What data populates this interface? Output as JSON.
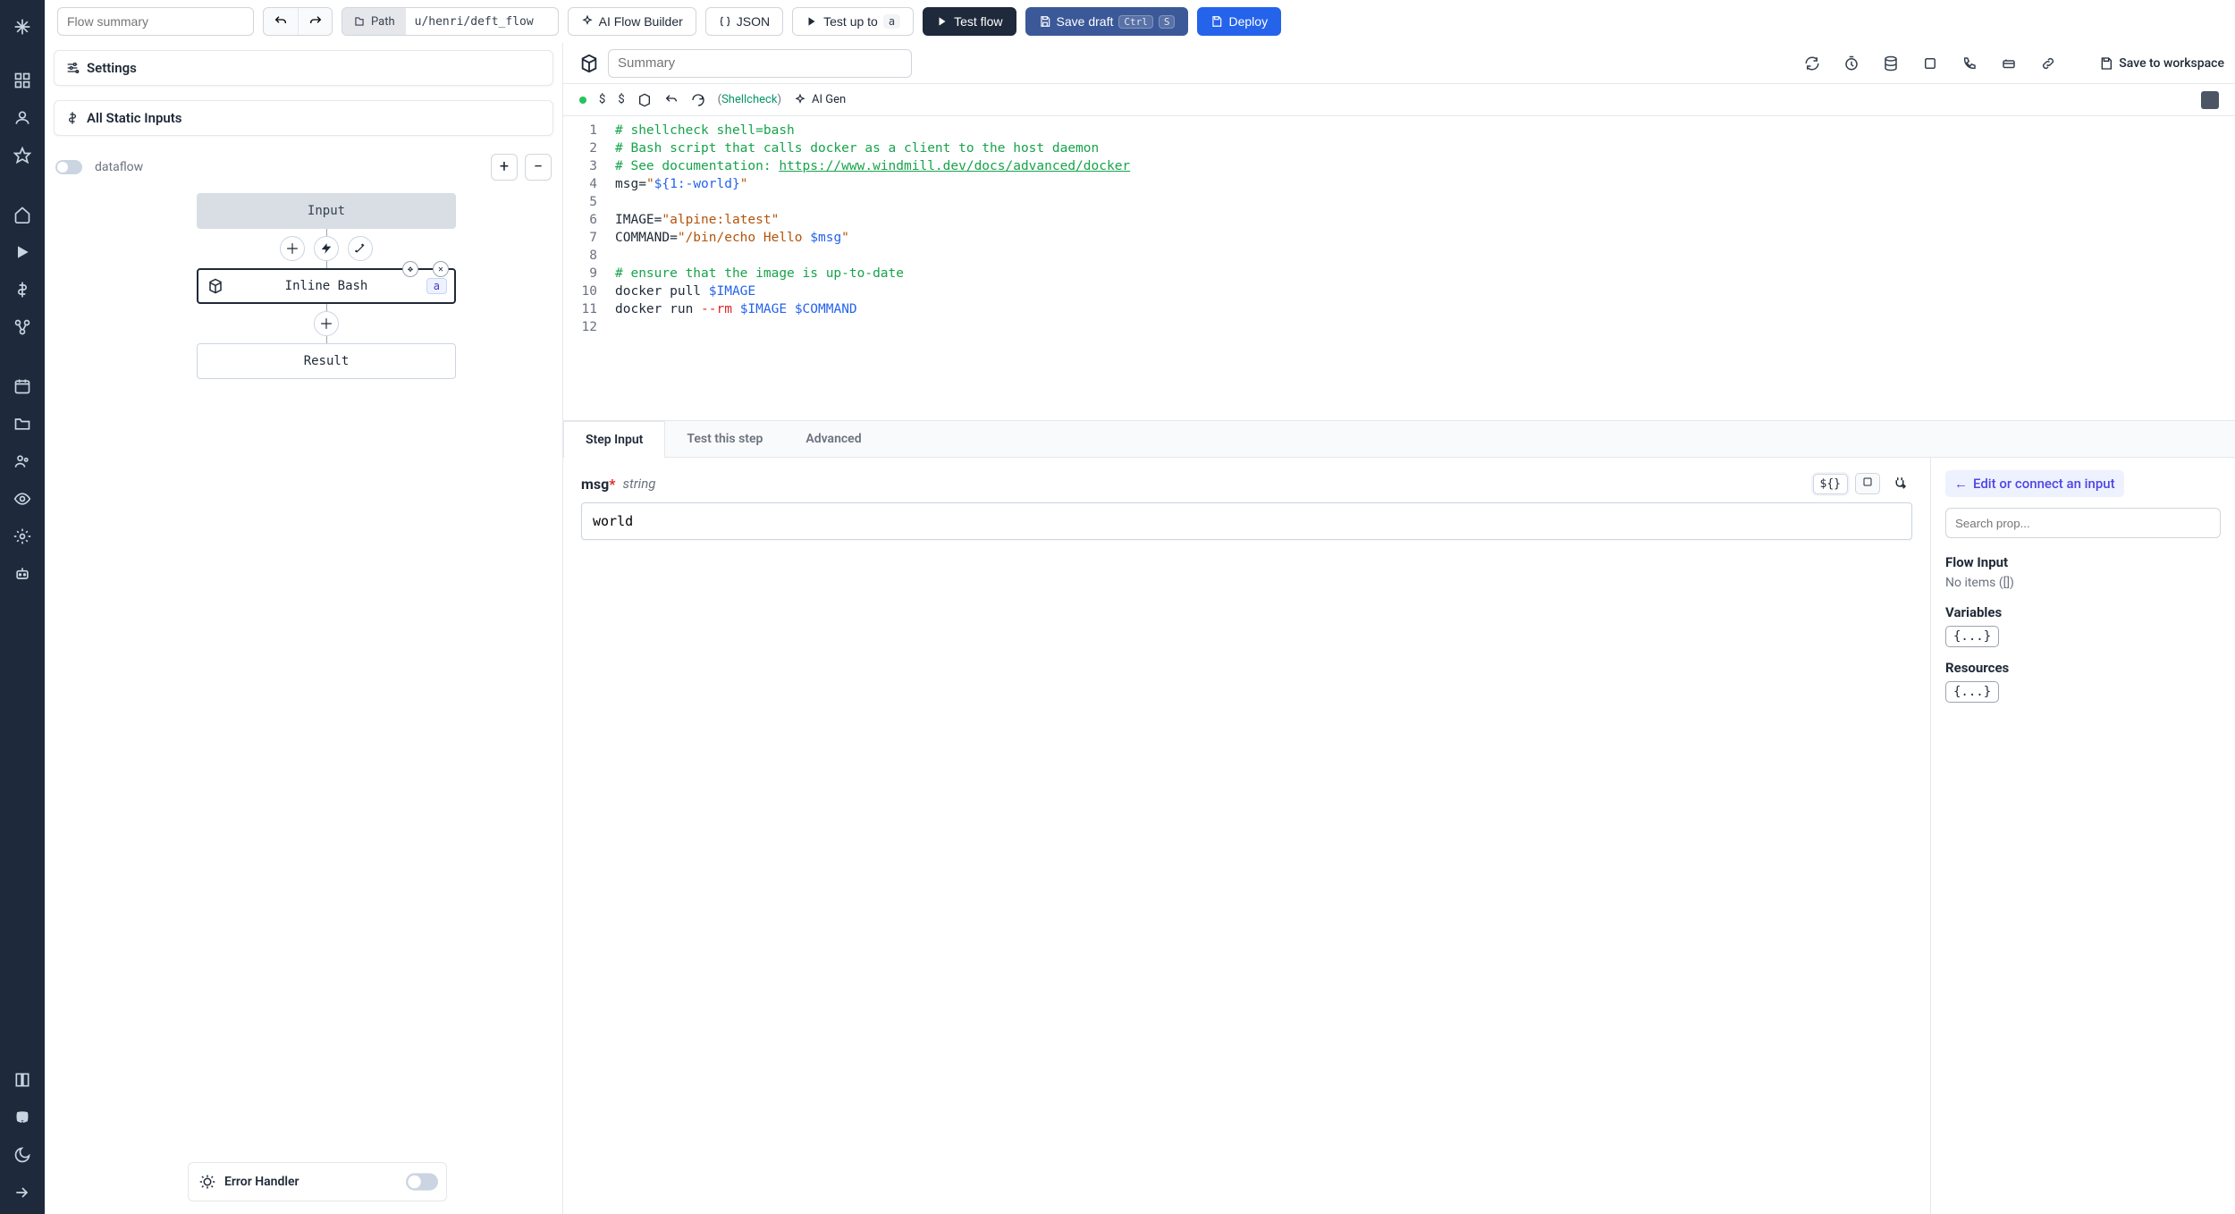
{
  "toolbar": {
    "summary_placeholder": "Flow summary",
    "path_label": "Path",
    "path_value": "u/henri/deft_flow",
    "ai_flow_builder": "AI Flow Builder",
    "json": "JSON",
    "test_up_to": "Test up to",
    "test_up_to_badge": "a",
    "test_flow": "Test flow",
    "save_draft": "Save draft",
    "save_draft_kbd1": "Ctrl",
    "save_draft_kbd2": "S",
    "deploy": "Deploy"
  },
  "cards": {
    "settings": "Settings",
    "all_static_inputs": "All Static Inputs"
  },
  "canvas": {
    "dataflow_label": "dataflow",
    "dataflow_on": false,
    "nodes": {
      "input": "Input",
      "step_a": "Inline Bash",
      "step_a_badge": "a",
      "result": "Result"
    },
    "error_handler": "Error Handler"
  },
  "editor_toolbar": {
    "summary_placeholder": "Summary",
    "save_workspace": "Save to workspace"
  },
  "editor_subbar": {
    "shellcheck_prefix": "(",
    "shellcheck_link": "Shellcheck",
    "shellcheck_suffix": ")",
    "ai_gen": "AI Gen"
  },
  "code": {
    "lines": [
      "# shellcheck shell=bash",
      "# Bash script that calls docker as a client to the host daemon",
      "# See documentation: https://www.windmill.dev/docs/advanced/docker",
      "msg=\"${1:-world}\"",
      "",
      "IMAGE=\"alpine:latest\"",
      "COMMAND=\"/bin/echo Hello $msg\"",
      "",
      "# ensure that the image is up-to-date",
      "docker pull $IMAGE",
      "docker run --rm $IMAGE $COMMAND",
      ""
    ]
  },
  "bottom_tabs": {
    "step_input": "Step Input",
    "test_step": "Test this step",
    "advanced": "Advanced"
  },
  "param": {
    "name": "msg",
    "required_marker": "*",
    "type": "string",
    "chip1": "${}",
    "value": "world"
  },
  "side": {
    "edit_connect": "Edit or connect an input",
    "search_placeholder": "Search prop...",
    "flow_input_title": "Flow Input",
    "no_items": "No items ([])",
    "variables_title": "Variables",
    "resources_title": "Resources",
    "brace": "{...}"
  }
}
